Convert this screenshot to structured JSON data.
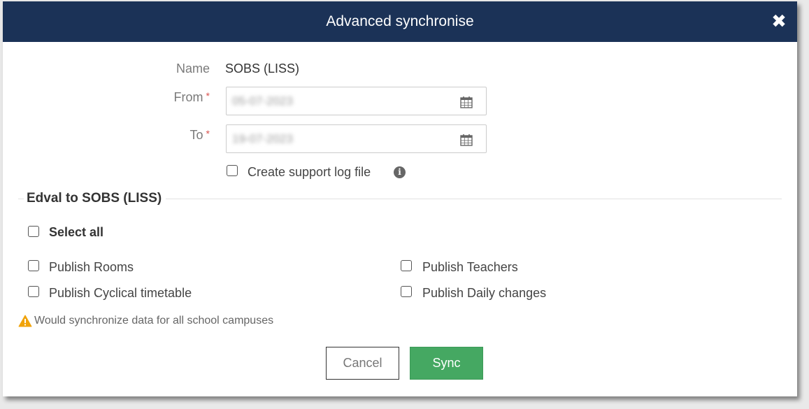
{
  "dialog": {
    "title": "Advanced synchronise",
    "close_icon": "close-icon"
  },
  "form": {
    "name_label": "Name",
    "name_value": "SOBS (LISS)",
    "from_label": "From",
    "to_label": "To",
    "required_mark": "*",
    "from_value": "05-07-2023",
    "to_value": "19-07-2023",
    "support_log_label": "Create support log file",
    "info_icon": "i"
  },
  "section": {
    "title": "Edval to SOBS (LISS)",
    "select_all_label": "Select all",
    "options": {
      "publish_rooms": "Publish Rooms",
      "publish_teachers": "Publish Teachers",
      "publish_cyclical": "Publish Cyclical timetable",
      "publish_daily": "Publish Daily changes"
    },
    "warning_text": "Would synchronize data for all school campuses"
  },
  "buttons": {
    "cancel": "Cancel",
    "sync": "Sync"
  },
  "colors": {
    "header_bg": "#1b3257",
    "sync_bg": "#45a862",
    "warning": "#f0a30a"
  }
}
